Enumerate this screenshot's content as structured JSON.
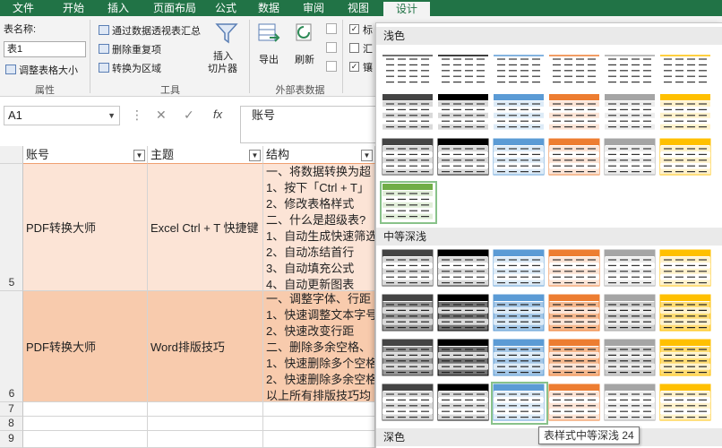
{
  "tabs": [
    "文件",
    "开始",
    "插入",
    "页面布局",
    "公式",
    "数据",
    "审阅",
    "视图",
    "设计"
  ],
  "ribbon": {
    "table_name_label": "表名称:",
    "table_name_value": "表1",
    "resize_table": "调整表格大小",
    "group_properties": "属性",
    "pivot_summary": "通过数据透视表汇总",
    "remove_duplicates": "删除重复项",
    "convert_range": "转换为区域",
    "group_tools": "工具",
    "insert_slicer_line1": "插入",
    "insert_slicer_line2": "切片器",
    "export": "导出",
    "refresh": "刷新",
    "group_external": "外部表数据",
    "opt1": "标",
    "opt2": "汇",
    "opt3": "镶"
  },
  "formula_bar": {
    "cell_ref": "A1",
    "content": "账号"
  },
  "sheet": {
    "headers": [
      "账号",
      "主题",
      "结构"
    ],
    "row_numbers": [
      "5",
      "6",
      "7",
      "8",
      "9"
    ],
    "rows": [
      {
        "account": "PDF转换大师",
        "topic": "Excel Ctrl + T 快捷键",
        "structure": [
          "一、将数据转换为超",
          "1、按下「Ctrl + T」",
          "2、修改表格样式",
          "二、什么是超级表?",
          "1、自动生成快速筛选",
          "2、自动冻结首行",
          "3、自动填充公式",
          "4、自动更新图表"
        ]
      },
      {
        "account": "PDF转换大师",
        "topic": "Word排版技巧",
        "structure": [
          "一、调整字体、行距",
          "1、快速调整文本字号",
          "2、快速改变行距",
          "二、删除多余空格、",
          "1、快速删除多个空格",
          "2、快速删除多余空格",
          "以上所有排版技巧均"
        ]
      }
    ]
  },
  "gallery": {
    "section_light": "浅色",
    "section_medium": "中等深浅",
    "section_dark": "深色",
    "tooltip": "表样式中等深浅 24"
  },
  "colors": {
    "excel_green": "#217346",
    "row5_fill": "#fce4d6",
    "row6_fill": "#f8cbad",
    "palette": [
      "#444444",
      "#000000",
      "#5b9bd5",
      "#ed7d31",
      "#a5a5a5",
      "#ffc000",
      "#4472c4",
      "#70ad47"
    ]
  }
}
